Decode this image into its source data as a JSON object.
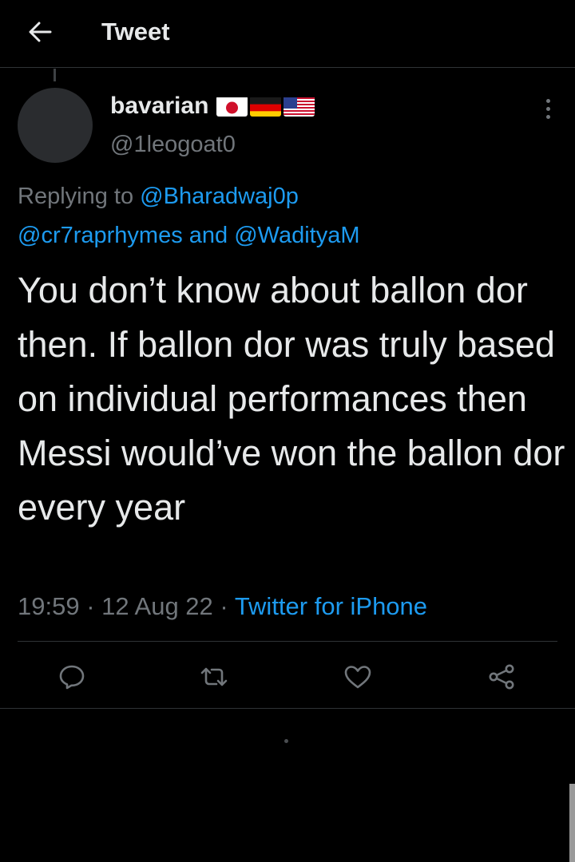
{
  "header": {
    "title": "Tweet"
  },
  "tweet": {
    "display_name": "bavarian",
    "flags": [
      "japan-flag-icon",
      "germany-flag-icon",
      "usa-flag-icon"
    ],
    "handle": "@1leogoat0",
    "replying_prefix": "Replying to",
    "mentions": [
      "@Bharadwaj0p",
      "@cr7raprhymes",
      "@WadityaM"
    ],
    "replying_and": "and",
    "text": "You don’t know about ballon dor then. If ballon dor was truly based on individual performances then Messi would’ve won the ballon dor every year",
    "time": "19:59",
    "separator": "·",
    "date": "12 Aug 22",
    "source": "Twitter for iPhone"
  },
  "actions": [
    "reply-icon",
    "retweet-icon",
    "like-icon",
    "share-icon"
  ],
  "colors": {
    "background": "#000000",
    "text": "#e7e9ea",
    "muted": "#71767b",
    "accent": "#1d9bf0",
    "border": "#2f3336"
  }
}
